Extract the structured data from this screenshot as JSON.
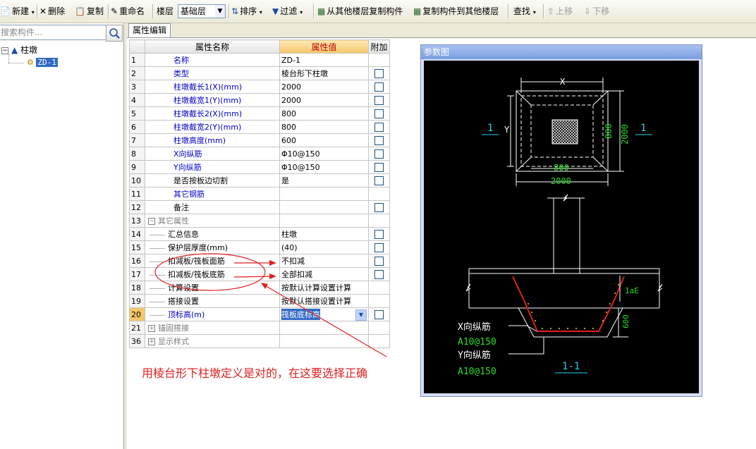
{
  "toolbar": {
    "new_label": "新建",
    "delete_label": "删除",
    "copy_label": "复制",
    "rename_label": "重命名",
    "floor_label": "楼层",
    "floor_value": "基础层",
    "sort_label": "排序",
    "filter_label": "过滤",
    "copy_from_floor_label": "从其他楼层复制构件",
    "copy_to_floor_label": "复制构件到其他楼层",
    "find_label": "查找",
    "move_up_label": "上移",
    "move_down_label": "下移"
  },
  "left_panel": {
    "search_placeholder": "搜索构件...",
    "tree_root": "柱墩",
    "tree_child": "ZD-1"
  },
  "tab": {
    "label": "属性编辑"
  },
  "grid": {
    "headers": {
      "name": "属性名称",
      "value": "属性值",
      "extra": "附加"
    },
    "rows": [
      {
        "num": "1",
        "name": "名称",
        "value": "ZD-1"
      },
      {
        "num": "2",
        "name": "类型",
        "value": "棱台形下柱墩"
      },
      {
        "num": "3",
        "name": "柱墩截长1(X)(mm)",
        "value": "2000"
      },
      {
        "num": "4",
        "name": "柱墩截宽1(Y)(mm)",
        "value": "2000"
      },
      {
        "num": "5",
        "name": "柱墩截长2(X)(mm)",
        "value": "800"
      },
      {
        "num": "6",
        "name": "柱墩截宽2(Y)(mm)",
        "value": "800"
      },
      {
        "num": "7",
        "name": "柱墩高度(mm)",
        "value": "600"
      },
      {
        "num": "8",
        "name": "X向纵筋",
        "value": "Φ10@150"
      },
      {
        "num": "9",
        "name": "Y向纵筋",
        "value": "Φ10@150"
      },
      {
        "num": "10",
        "name": "是否按板边切割",
        "value": "是"
      },
      {
        "num": "11",
        "name": "其它钢筋",
        "value": ""
      },
      {
        "num": "12",
        "name": "备注",
        "value": ""
      },
      {
        "num": "13",
        "name": "其它属性",
        "value": ""
      },
      {
        "num": "14",
        "name": "汇总信息",
        "value": "柱墩"
      },
      {
        "num": "15",
        "name": "保护层厚度(mm)",
        "value": "(40)"
      },
      {
        "num": "16",
        "name": "扣减板/筏板面筋",
        "value": "不扣减"
      },
      {
        "num": "17",
        "name": "扣减板/筏板底筋",
        "value": "全部扣减"
      },
      {
        "num": "18",
        "name": "计算设置",
        "value": "按默认计算设置计算"
      },
      {
        "num": "19",
        "name": "搭接设置",
        "value": "按默认搭接设置计算"
      },
      {
        "num": "20",
        "name": "顶标高(m)",
        "value": "筏板底标高"
      },
      {
        "num": "21",
        "name": "锚固搭接",
        "value": ""
      },
      {
        "num": "36",
        "name": "显示样式",
        "value": ""
      }
    ]
  },
  "annotation": {
    "note": "用棱台形下柱墩定义是对的，在这要选择正确"
  },
  "param_window": {
    "title": "参数图",
    "labels": {
      "x": "X",
      "y": "Y",
      "dim800_v": "800",
      "dim2000_v": "2000",
      "dim800_h": "800",
      "dim2000_h": "2000",
      "section_mark": "1",
      "lae": "1aE",
      "height": "600",
      "x_bar": "X向纵筋",
      "x_bar_spec": "A10@150",
      "y_bar": "Y向纵筋",
      "y_bar_spec": "A10@150",
      "section_title": "1-1"
    }
  }
}
